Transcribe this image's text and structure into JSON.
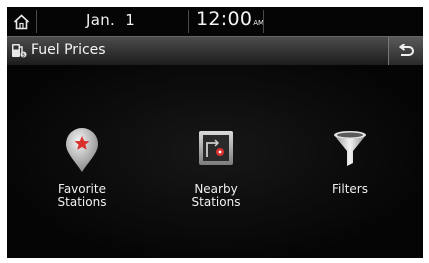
{
  "status": {
    "date": "Jan.  1",
    "time": "12:00",
    "ampm": "AM"
  },
  "header": {
    "title": "Fuel Prices",
    "title_icon": "fuel-pump-icon",
    "back_icon": "back-arrow-icon"
  },
  "menu": [
    {
      "line1": "Favorite",
      "line2": "Stations",
      "icon": "star-pin-icon"
    },
    {
      "line1": "Nearby",
      "line2": "Stations",
      "icon": "map-pin-icon"
    },
    {
      "line1": "Filters",
      "line2": "",
      "icon": "funnel-icon"
    }
  ],
  "colors": {
    "accent_red": "#d8312e",
    "text": "#f0f0f0",
    "background": "#000000"
  }
}
